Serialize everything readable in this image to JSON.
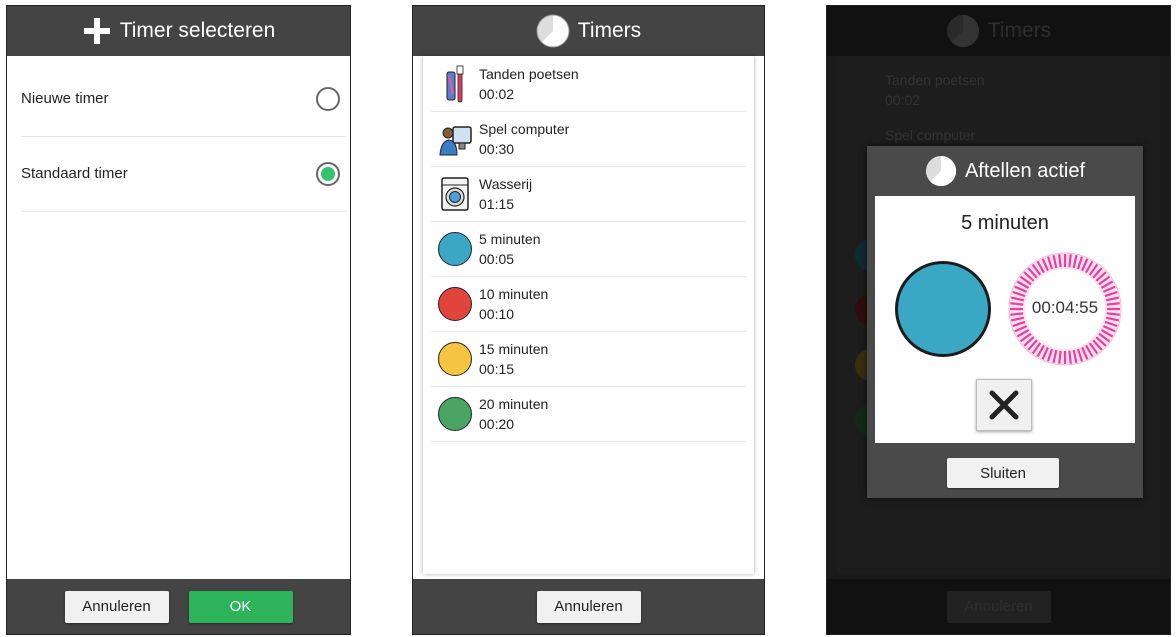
{
  "screen1": {
    "title": "Timer selecteren",
    "title_icon": "plus-icon",
    "options": [
      {
        "label": "Nieuwe timer",
        "selected": false
      },
      {
        "label": "Standaard timer",
        "selected": true
      }
    ],
    "cancel_label": "Annuleren",
    "ok_label": "OK"
  },
  "screen2": {
    "title": "Timers",
    "title_icon": "timer-icon",
    "timers": [
      {
        "name": "Tanden poetsen",
        "time": "00:02",
        "icon": "toothbrush-icon"
      },
      {
        "name": "Spel computer",
        "time": "00:30",
        "icon": "computer-icon"
      },
      {
        "name": "Wasserij",
        "time": "01:15",
        "icon": "washing-machine-icon"
      },
      {
        "name": "5 minuten",
        "time": "00:05",
        "icon": "circle-icon",
        "color": "#3aa7c4"
      },
      {
        "name": "10 minuten",
        "time": "00:10",
        "icon": "circle-icon",
        "color": "#e0443a"
      },
      {
        "name": "15 minuten",
        "time": "00:15",
        "icon": "circle-icon",
        "color": "#f5c542"
      },
      {
        "name": "20 minuten",
        "time": "00:20",
        "icon": "circle-icon",
        "color": "#4aa564"
      }
    ],
    "cancel_label": "Annuleren"
  },
  "screen3": {
    "bg_title": "Timers",
    "bg_timers": [
      {
        "name": "Tanden poetsen",
        "time": "00:02"
      },
      {
        "name": "Spel computer",
        "time": ""
      }
    ],
    "bg_cancel_label": "Annuleren",
    "modal": {
      "title": "Aftellen actief",
      "timer_name": "5 minuten",
      "circle_color": "#3aa7c4",
      "countdown": "00:04:55",
      "clock_color": "#f23c9b",
      "close_label": "Sluiten"
    }
  },
  "colors": {
    "bar": "#444444",
    "accent_green": "#2db35a",
    "radio_selected": "#34c26a"
  }
}
